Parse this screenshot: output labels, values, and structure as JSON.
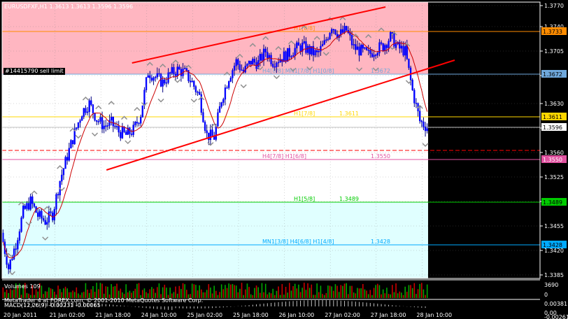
{
  "title": "EURUSDFXF,H1  1.3613 1.3613 1.3596 1.3596",
  "order_label": "#14415790 sell limit",
  "volume_label": "Volumes 109",
  "macd_label": "MACD(12,26,9) -0.00231 -0.00065",
  "broker_text": "MetaTrader 4 at FOREX.com, © 2001-2010 MetaQuotes Software Corp.",
  "chart_data": {
    "type": "candlestick",
    "symbol": "EURUSDFXF",
    "timeframe": "H1",
    "last_bar": {
      "open": 1.3613,
      "high": 1.3613,
      "low": 1.3596,
      "close": 1.3596
    },
    "ylim": [
      1.338,
      1.3775
    ],
    "price_ticks": [
      1.377,
      1.374,
      1.3705,
      1.367,
      1.363,
      1.3595,
      1.356,
      1.3525,
      1.349,
      1.3455,
      1.342,
      1.3385
    ],
    "x_ticks": [
      "20 Jan 2011",
      "21 Jan 02:00",
      "21 Jan 18:00",
      "24 Jan 10:00",
      "25 Jan 02:00",
      "25 Jan 18:00",
      "26 Jan 10:00",
      "27 Jan 02:00",
      "27 Jan 18:00",
      "28 Jan 10:00"
    ],
    "close_path": [
      1.3445,
      1.3395,
      1.343,
      1.3475,
      1.349,
      1.347,
      1.3462,
      1.3472,
      1.352,
      1.3555,
      1.3588,
      1.3618,
      1.363,
      1.3608,
      1.3598,
      1.3602,
      1.359,
      1.3585,
      1.3592,
      1.3615,
      1.3675,
      1.3668,
      1.366,
      1.3672,
      1.3678,
      1.3674,
      1.366,
      1.364,
      1.3585,
      1.3582,
      1.3636,
      1.3668,
      1.369,
      1.3675,
      1.369,
      1.3688,
      1.3705,
      1.369,
      1.3695,
      1.37,
      1.3708,
      1.3712,
      1.3705,
      1.37,
      1.3715,
      1.3742,
      1.3728,
      1.3735,
      1.371,
      1.3705,
      1.37,
      1.3708,
      1.3712,
      1.3725,
      1.371,
      1.3705,
      1.3648,
      1.3605,
      1.3596
    ],
    "levels": [
      {
        "price": 1.3733,
        "label": "H1[8/8]",
        "color": "#ff8c00",
        "tag_bg": "#ff8c00",
        "tag_fg": "#000000"
      },
      {
        "price": 1.3672,
        "label": "H4[8/8] MN1[7/8] H1[0/8]",
        "color": "#6fa8dc",
        "tag_bg": "#6fa8dc",
        "tag_fg": "#000000",
        "value_text": "1.3672"
      },
      {
        "price": 1.3611,
        "label": "H1[7/8]",
        "color": "#ffd700",
        "tag_bg": "#ffd700",
        "tag_fg": "#000000",
        "value_text": "1.3611"
      },
      {
        "price": 1.3596,
        "label": "",
        "color": "#c0c0c0",
        "tag_bg": "#ffffff",
        "tag_fg": "#000000"
      },
      {
        "price": 1.3563,
        "label": "",
        "color": "#ff0000",
        "dashed": true
      },
      {
        "price": 1.355,
        "label": "H4[7/8] H1[6/8]",
        "color": "#e052a0",
        "tag_bg": "#e052a0",
        "tag_fg": "#ffffff",
        "value_text": "1.3550"
      },
      {
        "price": 1.3489,
        "label": "H1[5/8]",
        "color": "#00cc00",
        "tag_bg": "#00cc00",
        "tag_fg": "#000000",
        "value_text": "1.3489"
      },
      {
        "price": 1.3428,
        "label": "MN1[3/8] H4[6/8] H1[4/8]",
        "color": "#00aaff",
        "tag_bg": "#00aaff",
        "tag_fg": "#000000",
        "value_text": "1.3428"
      }
    ],
    "zones": [
      {
        "from": 1.3775,
        "to": 1.3672,
        "color": "#ffb6c1"
      },
      {
        "from": 1.3672,
        "to": 1.3489,
        "color": "#ffffff"
      },
      {
        "from": 1.3489,
        "to": 1.338,
        "color": "#e0ffff"
      }
    ],
    "channel": {
      "upper": [
        [
          0.305,
          1.3688
        ],
        [
          0.9,
          1.3768
        ]
      ],
      "lower": [
        [
          0.245,
          1.3535
        ],
        [
          1.08,
          1.3692
        ]
      ],
      "color": "#ff0000"
    },
    "volume_axis": [
      3690,
      0
    ],
    "macd_axis": [
      0.00381,
      0.0,
      -0.00261
    ]
  }
}
